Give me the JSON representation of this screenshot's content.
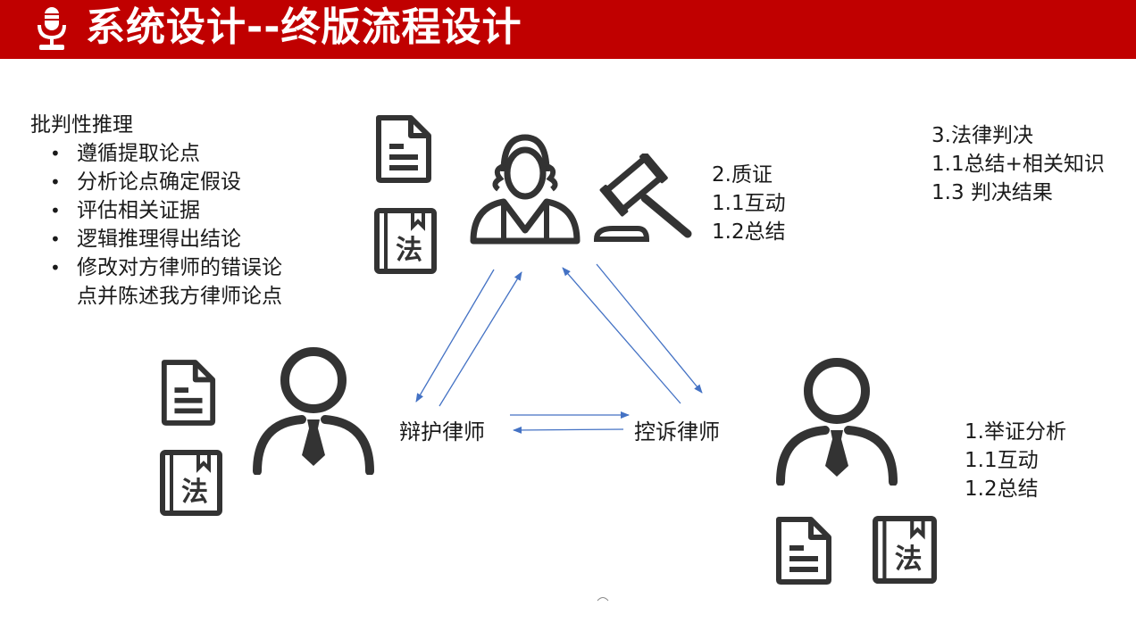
{
  "header": {
    "title": "系统设计--终版流程设计",
    "icon": "microphone-icon",
    "background_color": "#c00000"
  },
  "critical_reasoning": {
    "title": "批判性推理",
    "items": [
      {
        "lines": [
          "遵循提取论点"
        ]
      },
      {
        "lines": [
          "分析论点确定假设"
        ]
      },
      {
        "lines": [
          "评估相关证据"
        ]
      },
      {
        "lines": [
          "逻辑推理得出结论"
        ]
      },
      {
        "lines": [
          "修改对方律师的错误论",
          "点并陈述我方律师论点"
        ]
      }
    ]
  },
  "judge": {
    "steps": [
      "2.质证",
      "1.1互动",
      "1.2总结"
    ],
    "icons": [
      "document-icon",
      "law-book-icon",
      "judge-icon",
      "gavel-icon"
    ]
  },
  "verdict": {
    "steps": [
      "3.法律判决",
      "1.1总结+相关知识",
      "1.3 判决结果"
    ]
  },
  "prosecutor": {
    "steps": [
      "1.举证分析",
      "1.1互动",
      "1.2总结"
    ],
    "icons": [
      "lawyer-icon",
      "document-icon",
      "law-book-icon"
    ]
  },
  "roles": {
    "defense": "辩护律师",
    "prosecution": "控诉律师"
  },
  "book_glyph": "法",
  "arrow_color": "#4472c4"
}
